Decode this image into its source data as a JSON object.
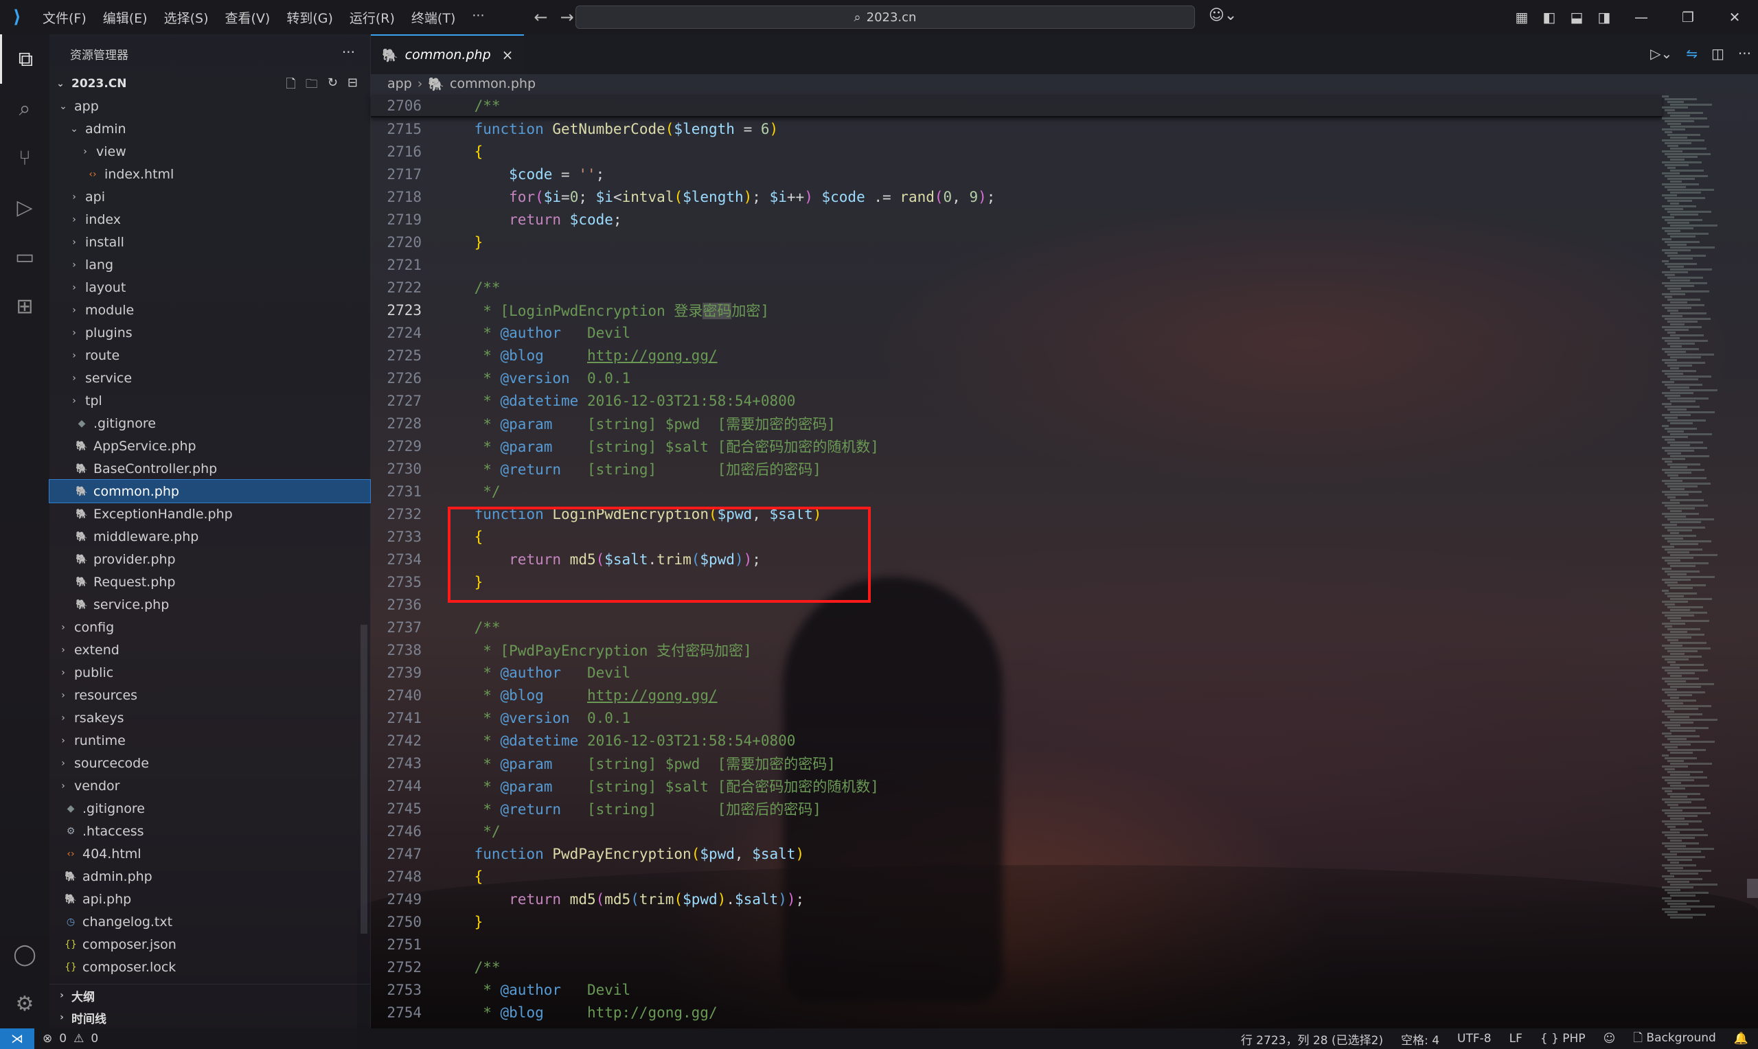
{
  "titlebar": {
    "menu": [
      "文件(F)",
      "编辑(E)",
      "选择(S)",
      "查看(V)",
      "转到(G)",
      "运行(R)",
      "终端(T)",
      "···"
    ],
    "search": "2023.cn"
  },
  "explorer": {
    "title": "资源管理器",
    "root": "2023.CN",
    "tree": [
      {
        "label": "app",
        "type": "folder",
        "open": true,
        "depth": 1
      },
      {
        "label": "admin",
        "type": "folder",
        "open": true,
        "depth": 2
      },
      {
        "label": "view",
        "type": "folder",
        "open": false,
        "depth": 3
      },
      {
        "label": "index.html",
        "type": "html",
        "depth": 3
      },
      {
        "label": "api",
        "type": "folder",
        "open": false,
        "depth": 2
      },
      {
        "label": "index",
        "type": "folder",
        "open": false,
        "depth": 2
      },
      {
        "label": "install",
        "type": "folder",
        "open": false,
        "depth": 2
      },
      {
        "label": "lang",
        "type": "folder",
        "open": false,
        "depth": 2
      },
      {
        "label": "layout",
        "type": "folder",
        "open": false,
        "depth": 2
      },
      {
        "label": "module",
        "type": "folder",
        "open": false,
        "depth": 2
      },
      {
        "label": "plugins",
        "type": "folder",
        "open": false,
        "depth": 2
      },
      {
        "label": "route",
        "type": "folder",
        "open": false,
        "depth": 2
      },
      {
        "label": "service",
        "type": "folder",
        "open": false,
        "depth": 2
      },
      {
        "label": "tpl",
        "type": "folder",
        "open": false,
        "depth": 2
      },
      {
        "label": ".gitignore",
        "type": "git",
        "depth": 2
      },
      {
        "label": "AppService.php",
        "type": "php",
        "depth": 2
      },
      {
        "label": "BaseController.php",
        "type": "php",
        "depth": 2
      },
      {
        "label": "common.php",
        "type": "php",
        "depth": 2,
        "selected": true
      },
      {
        "label": "ExceptionHandle.php",
        "type": "php",
        "depth": 2
      },
      {
        "label": "middleware.php",
        "type": "php",
        "depth": 2
      },
      {
        "label": "provider.php",
        "type": "php",
        "depth": 2
      },
      {
        "label": "Request.php",
        "type": "php",
        "depth": 2
      },
      {
        "label": "service.php",
        "type": "php",
        "depth": 2
      },
      {
        "label": "config",
        "type": "folder",
        "open": false,
        "depth": 1
      },
      {
        "label": "extend",
        "type": "folder",
        "open": false,
        "depth": 1
      },
      {
        "label": "public",
        "type": "folder",
        "open": false,
        "depth": 1
      },
      {
        "label": "resources",
        "type": "folder",
        "open": false,
        "depth": 1
      },
      {
        "label": "rsakeys",
        "type": "folder",
        "open": false,
        "depth": 1
      },
      {
        "label": "runtime",
        "type": "folder",
        "open": false,
        "depth": 1
      },
      {
        "label": "sourcecode",
        "type": "folder",
        "open": false,
        "depth": 1
      },
      {
        "label": "vendor",
        "type": "folder",
        "open": false,
        "depth": 1
      },
      {
        "label": ".gitignore",
        "type": "git",
        "depth": 1
      },
      {
        "label": ".htaccess",
        "type": "cfg",
        "depth": 1
      },
      {
        "label": "404.html",
        "type": "html",
        "depth": 1
      },
      {
        "label": "admin.php",
        "type": "php",
        "depth": 1
      },
      {
        "label": "api.php",
        "type": "php",
        "depth": 1
      },
      {
        "label": "changelog.txt",
        "type": "txt",
        "depth": 1
      },
      {
        "label": "composer.json",
        "type": "json",
        "depth": 1
      },
      {
        "label": "composer.lock",
        "type": "json",
        "depth": 1
      }
    ],
    "sections": [
      "大纲",
      "时间线"
    ]
  },
  "editor": {
    "tab": "common.php",
    "breadcrumb": [
      "app",
      "common.php"
    ]
  },
  "statusbar": {
    "errors": "0",
    "warnings": "0",
    "position": "行 2723，列 28 (已选择2)",
    "spaces": "空格: 4",
    "encoding": "UTF-8",
    "eol": "LF",
    "language": "PHP",
    "background": "Background"
  }
}
